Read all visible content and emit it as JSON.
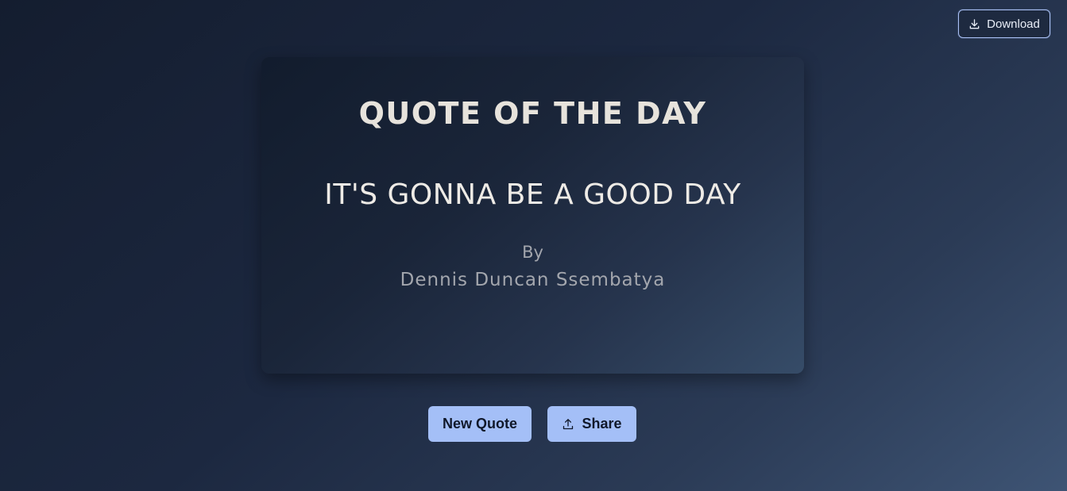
{
  "header": {
    "download_label": "Download",
    "download_icon": "download-icon"
  },
  "card": {
    "title": "QUOTE OF THE DAY",
    "quote": "IT'S GONNA BE A GOOD DAY",
    "by_label": "By",
    "author": "Dennis Duncan Ssembatya"
  },
  "actions": {
    "new_quote_label": "New Quote",
    "share_label": "Share",
    "share_icon": "upload-icon"
  },
  "colors": {
    "accent": "#a4bff7",
    "card_text": "#e7e3dc",
    "muted_text": "#a3a6ad"
  }
}
